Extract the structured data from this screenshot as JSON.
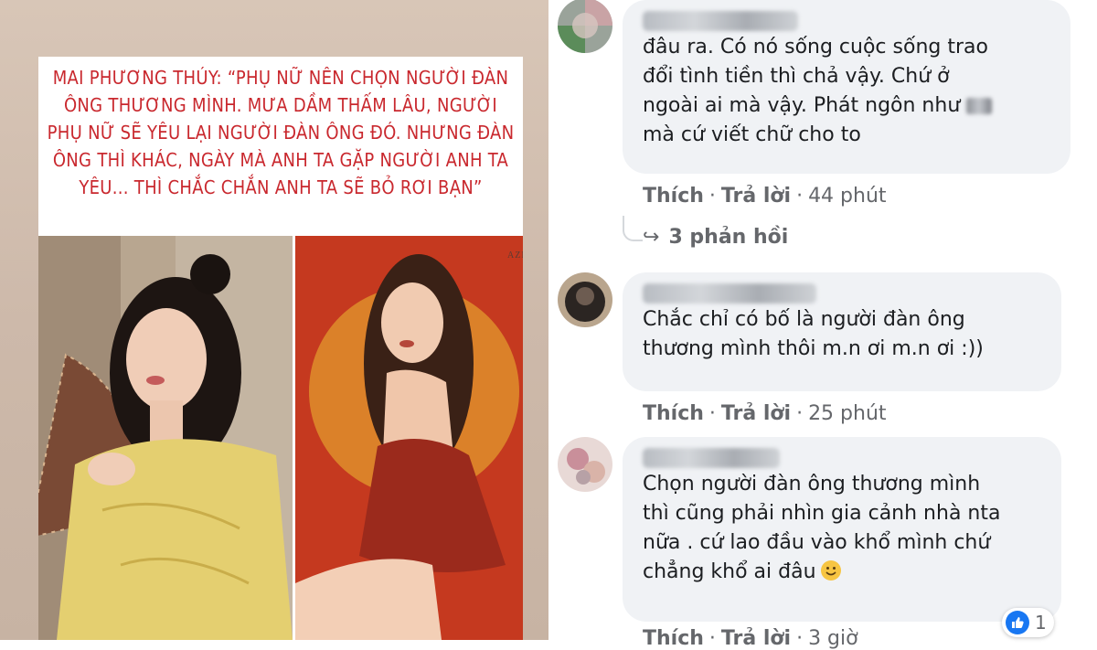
{
  "story": {
    "quote": "MAI PHƯƠNG THÚY: “PHỤ NỮ NÊN CHỌN NGƯỜI ĐÀN ÔNG THƯƠNG MÌNH. MƯA DẦM THẤM LÂU, NGƯỜI PHỤ NỮ SẼ YÊU LẠI NGƯỜI ĐÀN ÔNG ĐÓ. NHƯNG ĐÀN ÔNG THÌ KHÁC, NGÀY MÀ ANH TA GẶP NGƯỜI ANH TA YÊU... THÌ CHẮC CHẮN ANH TA SẼ BỎ RƠI BẠN”",
    "quote_color": "#c9282e",
    "magazine_text": "AZINE"
  },
  "comments": [
    {
      "text_before_blur": "đâu ra. Có nó sống cuộc sống trao\nđổi tình tiền thì chả vậy. Chứ ở\nngoài ai mà vậy. Phát ngôn như ",
      "text_after_blur": "\nmà cứ viết chữ cho to",
      "like_label": "Thích",
      "reply_label": "Trả lời",
      "time": "44 phút",
      "replies_label": "3 phản hồi"
    },
    {
      "text": "Chắc chỉ có bố là người đàn ông\nthương mình thôi m.n ơi m.n ơi :))",
      "like_label": "Thích",
      "reply_label": "Trả lời",
      "time": "25 phút"
    },
    {
      "text": "Chọn người đàn ông thương mình\nthì cũng phải nhìn gia cảnh nhà nta\nnữa . cứ lao đầu vào khổ mình chứ\nchẳng khổ ai đâu",
      "like_label": "Thích",
      "reply_label": "Trả lời",
      "time": "3 giờ",
      "reaction_count": "1"
    }
  ],
  "separator": "·",
  "colors": {
    "bubble": "#f0f2f5",
    "meta_text": "#65676b",
    "like_blue": "#1877f2"
  }
}
